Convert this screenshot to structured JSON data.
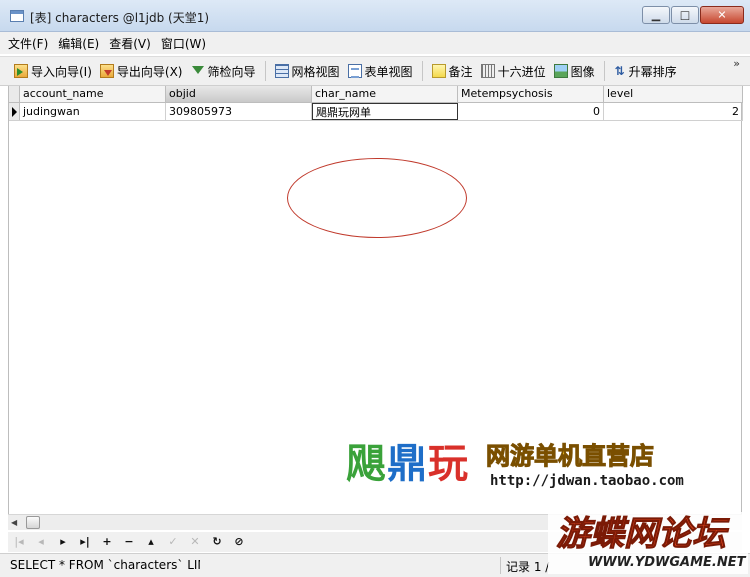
{
  "window": {
    "title": "[表] characters @l1jdb (天堂1)",
    "controls": [
      "minimize-icon",
      "maximize-icon",
      "close-icon"
    ]
  },
  "menu": {
    "items": [
      "文件(F)",
      "编辑(E)",
      "查看(V)",
      "窗口(W)"
    ]
  },
  "toolbar": {
    "import": "导入向导(I)",
    "export": "导出向导(X)",
    "filter": "筛检向导",
    "grid_view": "网格视图",
    "form_view": "表单视图",
    "memo": "备注",
    "hex": "十六进位",
    "image": "图像",
    "sort_asc": "升幂排序",
    "more": "»"
  },
  "table": {
    "columns": [
      "account_name",
      "objid",
      "char_name",
      "Metempsychosis",
      "level"
    ],
    "active_column": "objid",
    "rows": [
      [
        "judingwan",
        "309805973",
        "飓鼎玩网单",
        "0",
        "2"
      ]
    ]
  },
  "annotation": {
    "color": "#c0392b",
    "shape": "oval around char_name cell"
  },
  "watermark_logo": {
    "chars": [
      "飓",
      "鼎",
      "玩"
    ],
    "colors": [
      "#3aa23a",
      "#1e6ec8",
      "#d9302a"
    ],
    "tagline": "网游单机直营店",
    "url": "http://jdwan.taobao.com"
  },
  "navigator": {
    "buttons": [
      {
        "icon": "first-record-icon",
        "glyph": "|◂",
        "enabled": false
      },
      {
        "icon": "prev-record-icon",
        "glyph": "◂",
        "enabled": false
      },
      {
        "icon": "next-record-icon",
        "glyph": "▸",
        "enabled": true
      },
      {
        "icon": "last-record-icon",
        "glyph": "▸|",
        "enabled": true
      },
      {
        "icon": "add-record-icon",
        "glyph": "+",
        "enabled": true
      },
      {
        "icon": "delete-record-icon",
        "glyph": "−",
        "enabled": true
      },
      {
        "icon": "edit-record-icon",
        "glyph": "▴",
        "enabled": true
      },
      {
        "icon": "apply-icon",
        "glyph": "✓",
        "enabled": false
      },
      {
        "icon": "cancel-icon",
        "glyph": "✕",
        "enabled": false
      },
      {
        "icon": "refresh-icon",
        "glyph": "↻",
        "enabled": true
      },
      {
        "icon": "stop-icon",
        "glyph": "⊘",
        "enabled": true
      }
    ]
  },
  "status": {
    "sql": "SELECT * FROM `characters` LIMI",
    "record": "记录 1 /"
  },
  "forum_watermark": {
    "name": "游蝶网论坛",
    "url": "WWW.YDWGAME.NET"
  }
}
